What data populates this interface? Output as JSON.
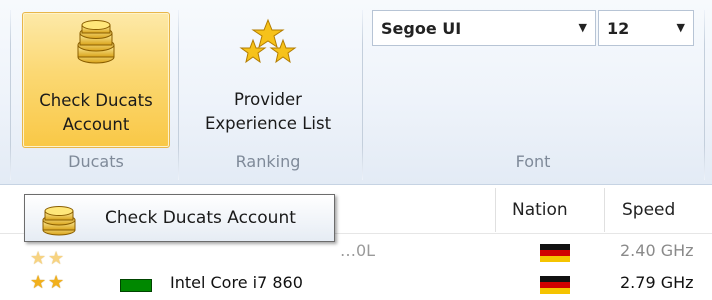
{
  "ribbon": {
    "groups": [
      {
        "label": "Ducats",
        "button_label": "Check Ducats Account",
        "icon": "coins-icon"
      },
      {
        "label": "Ranking",
        "button_label": "Provider Experience List",
        "icon": "stars-icon"
      },
      {
        "label": "Font"
      }
    ],
    "font": {
      "family": "Segoe UI",
      "size": "12"
    }
  },
  "table": {
    "columns": [
      "Nation",
      "Speed"
    ],
    "rows": [
      {
        "name": "…0L",
        "speed": "2.40 GHz",
        "nation_flag": "germany-flag",
        "stars": 2,
        "muted": true
      },
      {
        "name": "Intel Core i7 860",
        "speed": "2.79 GHz",
        "nation_flag": "germany-flag",
        "stars": 2,
        "status_color": "#008800",
        "muted": false
      }
    ]
  },
  "tooltip": {
    "text": "Check Ducats Account",
    "icon": "coins-icon"
  },
  "colors": {
    "accent": "#f9c846",
    "status_green": "#008800"
  }
}
